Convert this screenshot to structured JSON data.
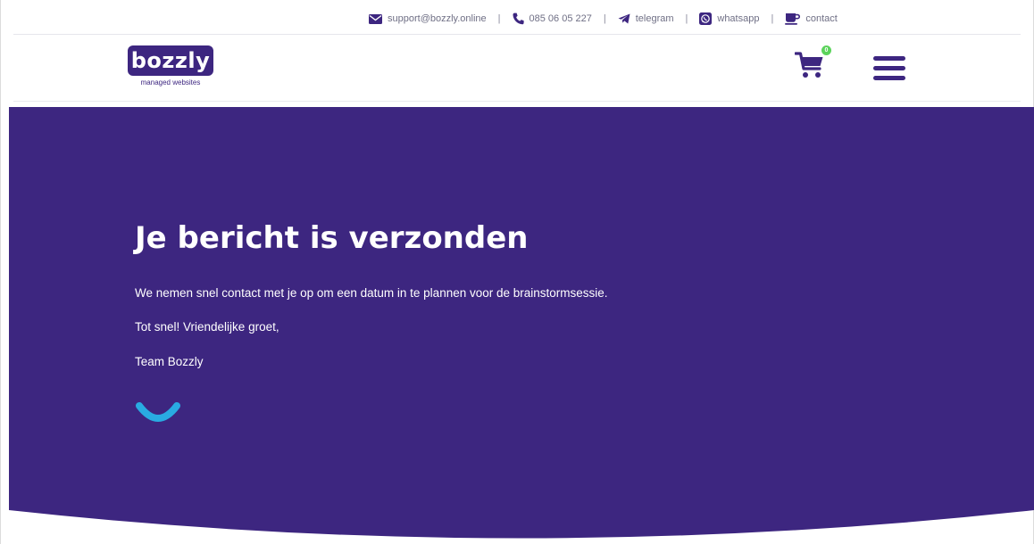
{
  "topbar": {
    "contacts": [
      {
        "icon": "envelope-icon",
        "label": "support@bozzly.online"
      },
      {
        "icon": "phone-icon",
        "label": "085 06 05 227"
      },
      {
        "icon": "telegram-icon",
        "label": "telegram"
      },
      {
        "icon": "whatsapp-icon",
        "label": "whatsapp"
      },
      {
        "icon": "cup-icon",
        "label": "contact"
      }
    ],
    "separator": "|"
  },
  "header": {
    "logo_text": "bozzly",
    "logo_tagline": "managed websites",
    "cart_count": "0",
    "cart_icon": "shopping-cart-icon",
    "menu_icon": "hamburger-menu-icon"
  },
  "hero": {
    "title": "Je bericht is verzonden",
    "paragraphs": [
      "We nemen snel contact met je op om een datum in te plannen voor de brainstormsessie.",
      "Tot snel! Vriendelijke groet,",
      "Team Bozzly"
    ],
    "decoration_icon": "smile-icon"
  },
  "colors": {
    "brand_purple": "#3d2680",
    "accent_blue": "#29abe2",
    "badge_green": "#5cd35c",
    "muted_text": "#6f6f85"
  }
}
